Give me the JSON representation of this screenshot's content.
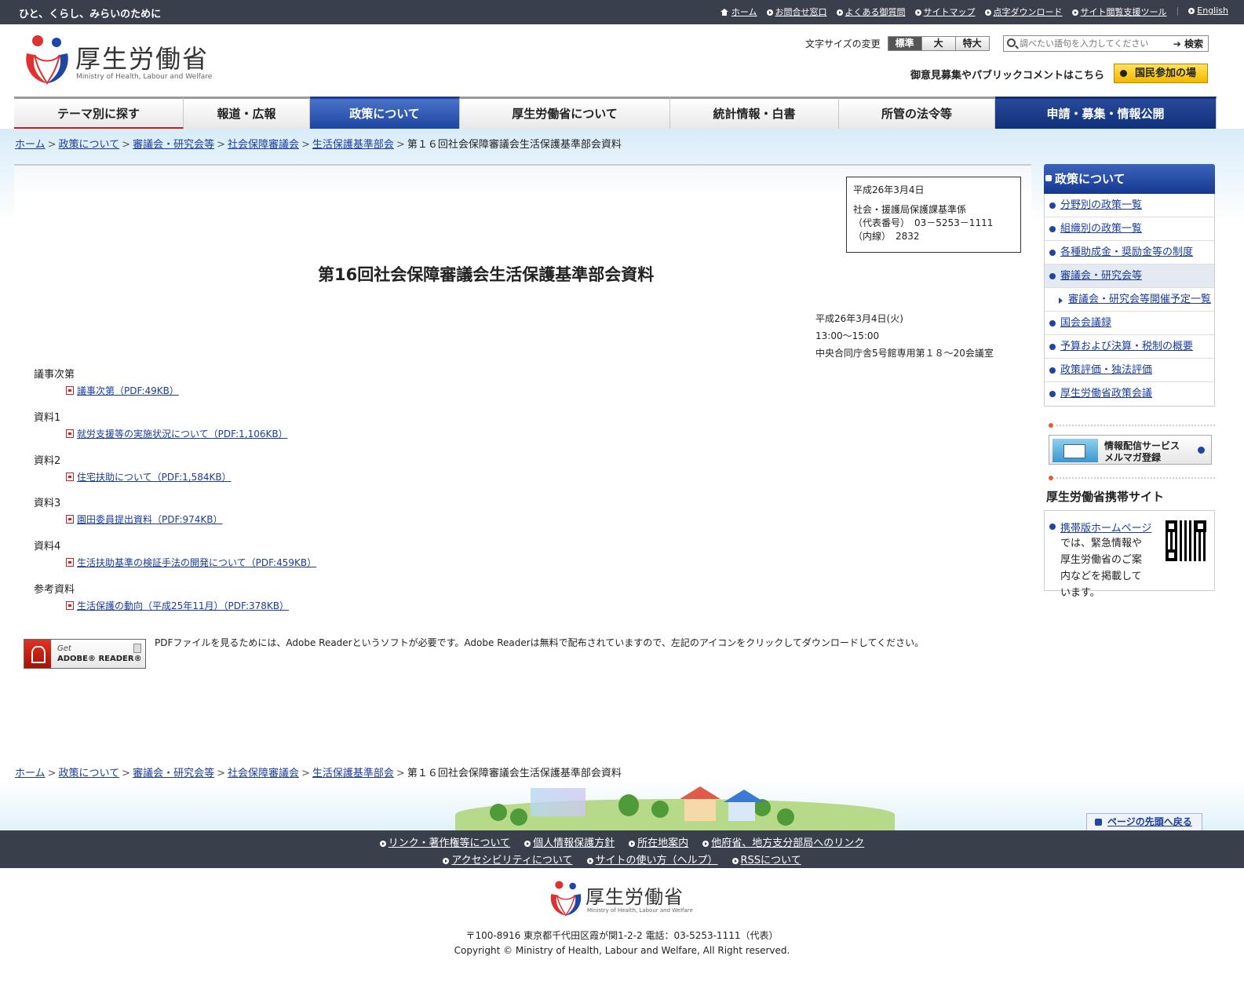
{
  "topbar": {
    "tagline": "ひと、くらし、みらいのために",
    "links": [
      "ホーム",
      "お問合せ窓口",
      "よくある御質問",
      "サイトマップ",
      "点字ダウンロード",
      "サイト閲覧支援ツール",
      "English"
    ]
  },
  "header": {
    "logo_text": "厚生労働省",
    "logo_sub": "Ministry of Health, Labour and Welfare",
    "fontsize_label": "文字サイズの変更",
    "fontsize_options": [
      "標準",
      "大",
      "特大"
    ],
    "search_placeholder": "調べたい語句を入力してください",
    "search_button": "検索",
    "public_comment": "御意見募集やパブリックコメントはこちら",
    "kokumin_button": "国民参加の場"
  },
  "gnav": [
    "テーマ別に探す",
    "報道・広報",
    "政策について",
    "厚生労働省について",
    "統計情報・白書",
    "所管の法令等",
    "申請・募集・情報公開"
  ],
  "breadcrumb": {
    "links": [
      "ホーム",
      "政策について",
      "審議会・研究会等",
      "社会保障審議会",
      "生活保護基準部会"
    ],
    "current": "第１６回社会保障審議会生活保護基準部会資料"
  },
  "infobox": {
    "date": "平成26年3月4日",
    "dept": "社会・援護局保護課基準係",
    "tel": "（代表番号）　03－5253－1111",
    "ext": "（内線）　2832"
  },
  "page_title": "第16回社会保障審議会生活保護基準部会資料",
  "meeting": {
    "date": "平成26年3月4日(火)",
    "time": "13:00～15:00",
    "place": "中央合同庁舎5号館専用第１８～20会議室"
  },
  "documents": [
    {
      "label": "議事次第",
      "link": "議事次第（PDF:49KB）"
    },
    {
      "label": "資料1",
      "link": "就労支援等の実施状況について（PDF:1,106KB）"
    },
    {
      "label": "資料2",
      "link": "住宅扶助について（PDF:1,584KB）"
    },
    {
      "label": "資料3",
      "link": "園田委員提出資料（PDF:974KB）"
    },
    {
      "label": "資料4",
      "link": "生活扶助基準の検証手法の開発について（PDF:459KB）"
    },
    {
      "label": "参考資料",
      "link": "生活保護の動向（平成25年11月）（PDF:378KB）"
    }
  ],
  "adobe": {
    "get": "Get",
    "reader": "ADOBE® READER®",
    "note": "PDFファイルを見るためには、Adobe Readerというソフトが必要です。Adobe Readerは無料で配布されていますので、左記のアイコンをクリックしてダウンロードしてください。"
  },
  "sidebar": {
    "title": "政策について",
    "items": [
      "分野別の政策一覧",
      "組織別の政策一覧",
      "各種助成金・奨励金等の制度",
      "審議会・研究会等",
      "審議会・研究会等開催予定一覧",
      "国会会議録",
      "予算および決算・税制の概要",
      "政策評価・独法評価",
      "厚生労働省政策会議"
    ],
    "mail_title1": "情報配信サービス",
    "mail_title2": "メルマガ登録",
    "mobile_title": "厚生労働省携帯サイト",
    "mobile_link": "携帯版ホームページ",
    "mobile_text": "では、緊急情報や厚生労働省のご案内などを掲載しています。"
  },
  "pagetop": "ページの先頭へ戻る",
  "footer": {
    "row1": [
      "リンク・著作権等について",
      "個人情報保護方針",
      "所在地案内",
      "他府省、地方支分部局へのリンク"
    ],
    "row2": [
      "アクセシビリティについて",
      "サイトの使い方（ヘルプ）",
      "RSSについて"
    ],
    "logo_text": "厚生労働省",
    "logo_sub": "Ministry of Health, Labour and Welfare",
    "address": "〒100-8916 東京都千代田区霞が関1-2-2 電話：03-5253-1111（代表）",
    "copyright": "Copyright © Ministry of Health, Labour and Welfare, All Right reserved."
  },
  "colors": {
    "nav_blue": "#1e46a2",
    "nav_navy": "#10307a",
    "topbar": "#3a3f4c",
    "logo_red": "#e03030",
    "logo_blue": "#1e46a2"
  }
}
